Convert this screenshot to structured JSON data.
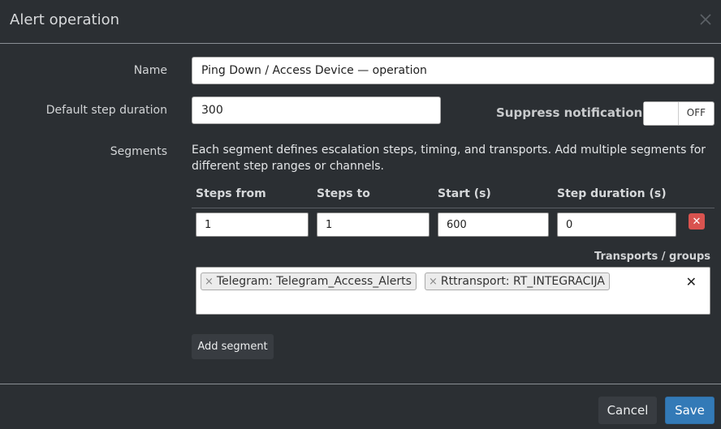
{
  "dialog": {
    "title": "Alert operation"
  },
  "form": {
    "name_label": "Name",
    "name_value": "Ping Down / Access Device — operation",
    "duration_label": "Default step duration",
    "duration_value": "300",
    "suppress_label": "Suppress notifications",
    "suppress_state": "OFF",
    "segments_label": "Segments",
    "segments_description": "Each segment defines escalation steps, timing, and transports. Add multiple segments for different step ranges or channels."
  },
  "segment_table": {
    "columns": [
      "Steps from",
      "Steps to",
      "Start (s)",
      "Step duration (s)"
    ],
    "rows": [
      {
        "steps_from": "1",
        "steps_to": "1",
        "start": "600",
        "step_duration": "0"
      }
    ],
    "delete_symbol": "✕"
  },
  "transports": {
    "label": "Transports / groups",
    "tags": [
      "Telegram: Telegram_Access_Alerts",
      "Rttransport: RT_INTEGRACIJA"
    ],
    "tag_remove_symbol": "×",
    "clear_symbol": "✕"
  },
  "buttons": {
    "add_segment": "Add segment",
    "cancel": "Cancel",
    "save": "Save"
  },
  "colors": {
    "background": "#2b2f33",
    "primary": "#337ab7",
    "danger": "#d9534f",
    "secondary": "#383c41"
  }
}
